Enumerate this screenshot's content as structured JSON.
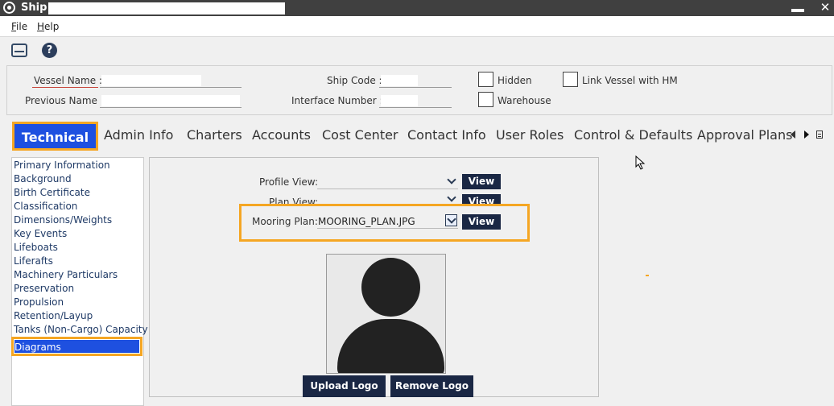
{
  "window": {
    "title": "Ship -"
  },
  "menu": {
    "file": "File",
    "help": "Help"
  },
  "header": {
    "vessel_name_label": "Vessel Name :",
    "previous_name_label": "Previous Name :",
    "ship_code_label": "Ship Code :",
    "interface_number_label": "Interface Number :",
    "hidden_label": "Hidden",
    "warehouse_label": "Warehouse",
    "link_vessel_label": "Link Vessel with HM"
  },
  "tabs": [
    "Technical",
    "Admin Info",
    "Charters",
    "Accounts",
    "Cost Center",
    "Contact Info",
    "User Roles",
    "Control & Defaults",
    "Approval Plans"
  ],
  "side_items": [
    "Primary Information",
    "Background",
    "Birth Certificate",
    "Classification",
    "Dimensions/Weights",
    "Key Events",
    "Lifeboats",
    "Liferafts",
    "Machinery Particulars",
    "Preservation",
    "Propulsion",
    "Retention/Layup",
    "Tanks (Non-Cargo) Capacity",
    "Diagrams"
  ],
  "diagrams": {
    "profile_view_label": "Profile View:",
    "plan_view_label": "Plan View:",
    "mooring_plan_label": "Mooring Plan:",
    "mooring_plan_value": "MOORING_PLAN.JPG",
    "view_label": "View",
    "upload_logo": "Upload Logo",
    "remove_logo": "Remove Logo"
  },
  "colors": {
    "accent": "#1e50e0",
    "highlight": "#f5a623",
    "dark_button": "#1a2744"
  }
}
